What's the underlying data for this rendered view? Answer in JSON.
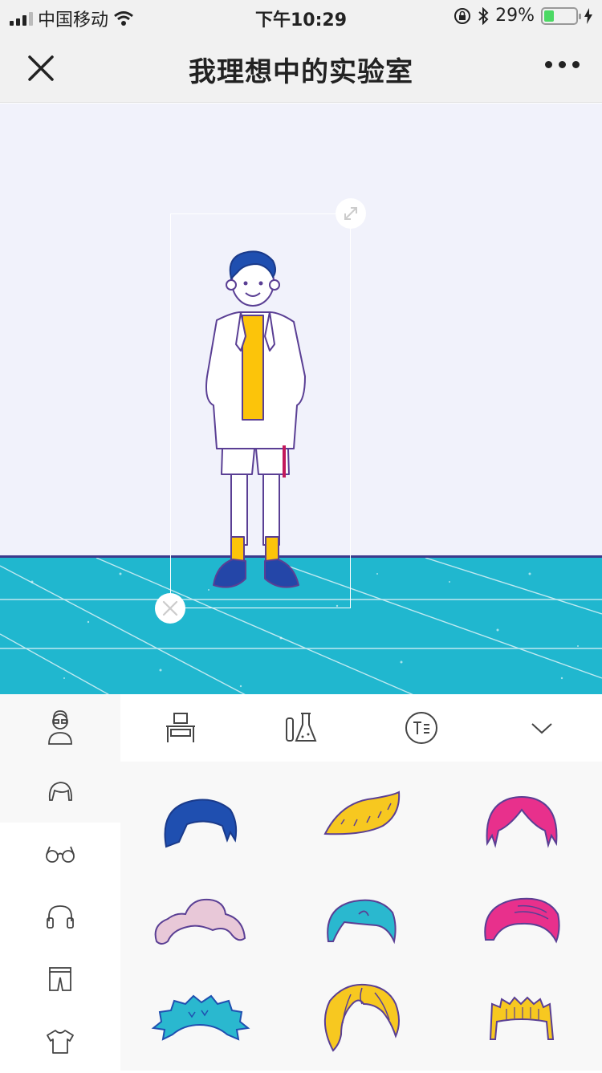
{
  "status": {
    "carrier": "中国移动",
    "time": "下午10:29",
    "battery": "29%",
    "battery_level": 0.29
  },
  "nav": {
    "title": "我理想中的实验室",
    "close_icon": "close-icon",
    "more_icon": "more-icon"
  },
  "categories": [
    {
      "icon": "table-icon"
    },
    {
      "icon": "flask-icon"
    },
    {
      "icon": "text-icon"
    },
    {
      "icon": "chevron-down-icon"
    }
  ],
  "sidebar": [
    {
      "icon": "person-icon"
    },
    {
      "icon": "hair-icon"
    },
    {
      "icon": "glasses-icon"
    },
    {
      "icon": "headphones-icon"
    },
    {
      "icon": "shorts-icon"
    },
    {
      "icon": "tshirt-icon"
    }
  ],
  "hair_colors": [
    "#1f4fb0",
    "#f7c820",
    "#e8308c",
    "#e8c8d8",
    "#2ab8cf",
    "#e8308c",
    "#2ab8cf",
    "#f7c820",
    "#f7c820"
  ],
  "colors": {
    "floor": "#20b7cf",
    "wall": "#f1f2fb",
    "outline": "#5a3f94",
    "shirt": "#fcc40a"
  }
}
